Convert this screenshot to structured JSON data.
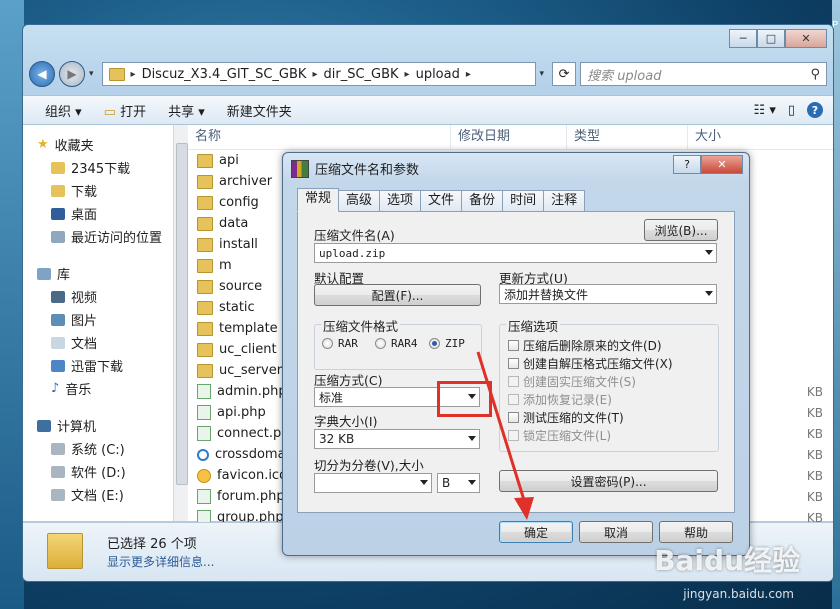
{
  "explorer": {
    "breadcrumb": [
      "Discuz_X3.4_GIT_SC_GBK",
      "dir_SC_GBK",
      "upload"
    ],
    "search_placeholder": "搜索 upload",
    "toolbar": {
      "organize": "组织 ▾",
      "open": "打开",
      "share": "共享 ▾",
      "new_folder": "新建文件夹"
    },
    "nav": {
      "favorites_header": "收藏夹",
      "favorites": [
        "2345下载",
        "下载",
        "桌面",
        "最近访问的位置"
      ],
      "libraries_header": "库",
      "libraries": [
        "视频",
        "图片",
        "文档",
        "迅雷下载",
        "音乐"
      ],
      "computer_header": "计算机",
      "drives": [
        "系统 (C:)",
        "软件 (D:)",
        "文档 (E:)"
      ]
    },
    "columns": [
      "名称",
      "修改日期",
      "类型",
      "大小"
    ],
    "files": [
      {
        "name": "api",
        "type": "folder"
      },
      {
        "name": "archiver",
        "type": "folder"
      },
      {
        "name": "config",
        "type": "folder"
      },
      {
        "name": "data",
        "type": "folder"
      },
      {
        "name": "install",
        "type": "folder"
      },
      {
        "name": "m",
        "type": "folder"
      },
      {
        "name": "source",
        "type": "folder"
      },
      {
        "name": "static",
        "type": "folder"
      },
      {
        "name": "template",
        "type": "folder"
      },
      {
        "name": "uc_client",
        "type": "folder"
      },
      {
        "name": "uc_server",
        "type": "folder"
      },
      {
        "name": "admin.php",
        "type": "php",
        "size": "KB"
      },
      {
        "name": "api.php",
        "type": "php",
        "size": "KB"
      },
      {
        "name": "connect.php",
        "type": "php",
        "size": "KB"
      },
      {
        "name": "crossdomain.xml",
        "type": "ie",
        "size": "KB"
      },
      {
        "name": "favicon.ico",
        "type": "ico",
        "size": "KB"
      },
      {
        "name": "forum.php",
        "type": "php",
        "size": "KB"
      },
      {
        "name": "group.php",
        "type": "php",
        "size": "KB"
      }
    ],
    "status": {
      "selected": "已选择 26 个项",
      "more": "显示更多详细信息..."
    }
  },
  "dialog": {
    "title": "压缩文件名和参数",
    "tabs": [
      "常规",
      "高级",
      "选项",
      "文件",
      "备份",
      "时间",
      "注释"
    ],
    "archive_name_label": "压缩文件名(A)",
    "browse_button": "浏览(B)...",
    "archive_name": "upload.zip",
    "default_profile_label": "默认配置",
    "profiles_button": "配置(F)...",
    "update_mode_label": "更新方式(U)",
    "update_mode": "添加并替换文件",
    "format_label": "压缩文件格式",
    "formats": [
      "RAR",
      "RAR4",
      "ZIP"
    ],
    "selected_format": "ZIP",
    "options_label": "压缩选项",
    "options": [
      {
        "label": "压缩后删除原来的文件(D)",
        "enabled": true
      },
      {
        "label": "创建自解压格式压缩文件(X)",
        "enabled": true
      },
      {
        "label": "创建固实压缩文件(S)",
        "enabled": false
      },
      {
        "label": "添加恢复记录(E)",
        "enabled": false
      },
      {
        "label": "测试压缩的文件(T)",
        "enabled": true
      },
      {
        "label": "锁定压缩文件(L)",
        "enabled": false
      }
    ],
    "method_label": "压缩方式(C)",
    "method": "标准",
    "dict_label": "字典大小(I)",
    "dict": "32 KB",
    "split_label": "切分为分卷(V),大小",
    "split_unit": "B",
    "password_button": "设置密码(P)...",
    "ok": "确定",
    "cancel": "取消",
    "help": "帮助"
  },
  "watermark": {
    "brand": "Baidu经验",
    "url": "jingyan.baidu.com"
  },
  "colors": {
    "highlight_red": "#e0302a",
    "accent_blue": "#2a6bb5"
  }
}
